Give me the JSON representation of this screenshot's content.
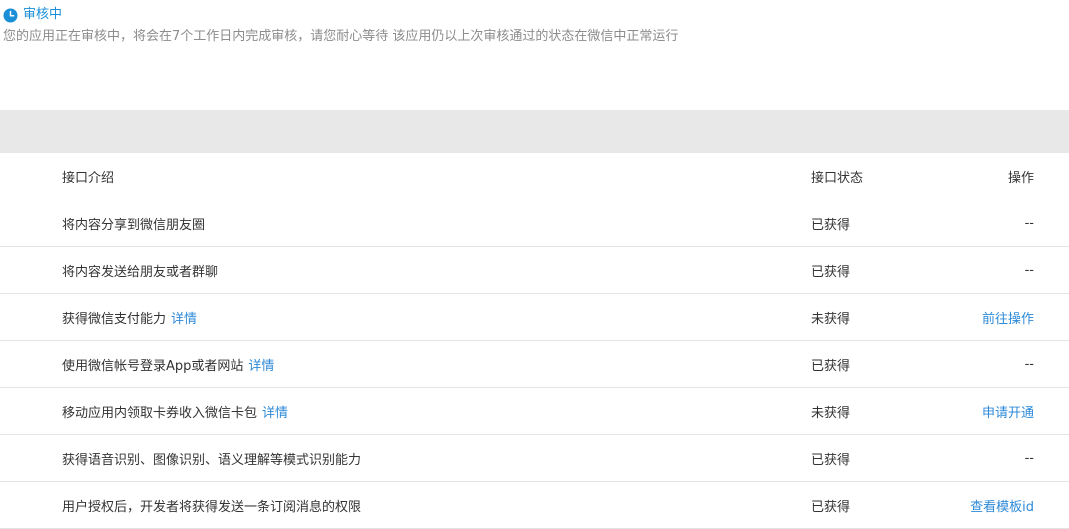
{
  "review": {
    "icon": "clock-icon",
    "title": "审核中",
    "description": "您的应用正在审核中，将会在7个工作日内完成审核，请您耐心等待 该应用仍以上次审核通过的状态在微信中正常运行",
    "accent_color": "#1a8fd8"
  },
  "table": {
    "headers": {
      "name": "接口介绍",
      "status": "接口状态",
      "action": "操作"
    },
    "rows": [
      {
        "name": "将内容分享到微信朋友圈",
        "detail": "",
        "status": "已获得",
        "action": "--",
        "action_is_link": false
      },
      {
        "name": "将内容发送给朋友或者群聊",
        "detail": "",
        "status": "已获得",
        "action": "--",
        "action_is_link": false
      },
      {
        "name": "获得微信支付能力",
        "detail": "详情",
        "status": "未获得",
        "action": "前往操作",
        "action_is_link": true
      },
      {
        "name": "使用微信帐号登录App或者网站",
        "detail": "详情",
        "status": "已获得",
        "action": "--",
        "action_is_link": false
      },
      {
        "name": "移动应用内领取卡券收入微信卡包",
        "detail": "详情",
        "status": "未获得",
        "action": "申请开通",
        "action_is_link": true
      },
      {
        "name": "获得语音识别、图像识别、语义理解等模式识别能力",
        "detail": "",
        "status": "已获得",
        "action": "--",
        "action_is_link": false
      },
      {
        "name": "用户授权后，开发者将获得发送一条订阅消息的权限",
        "detail": "",
        "status": "已获得",
        "action": "查看模板id",
        "action_is_link": true
      }
    ],
    "link_color": "#2d8ad8"
  }
}
